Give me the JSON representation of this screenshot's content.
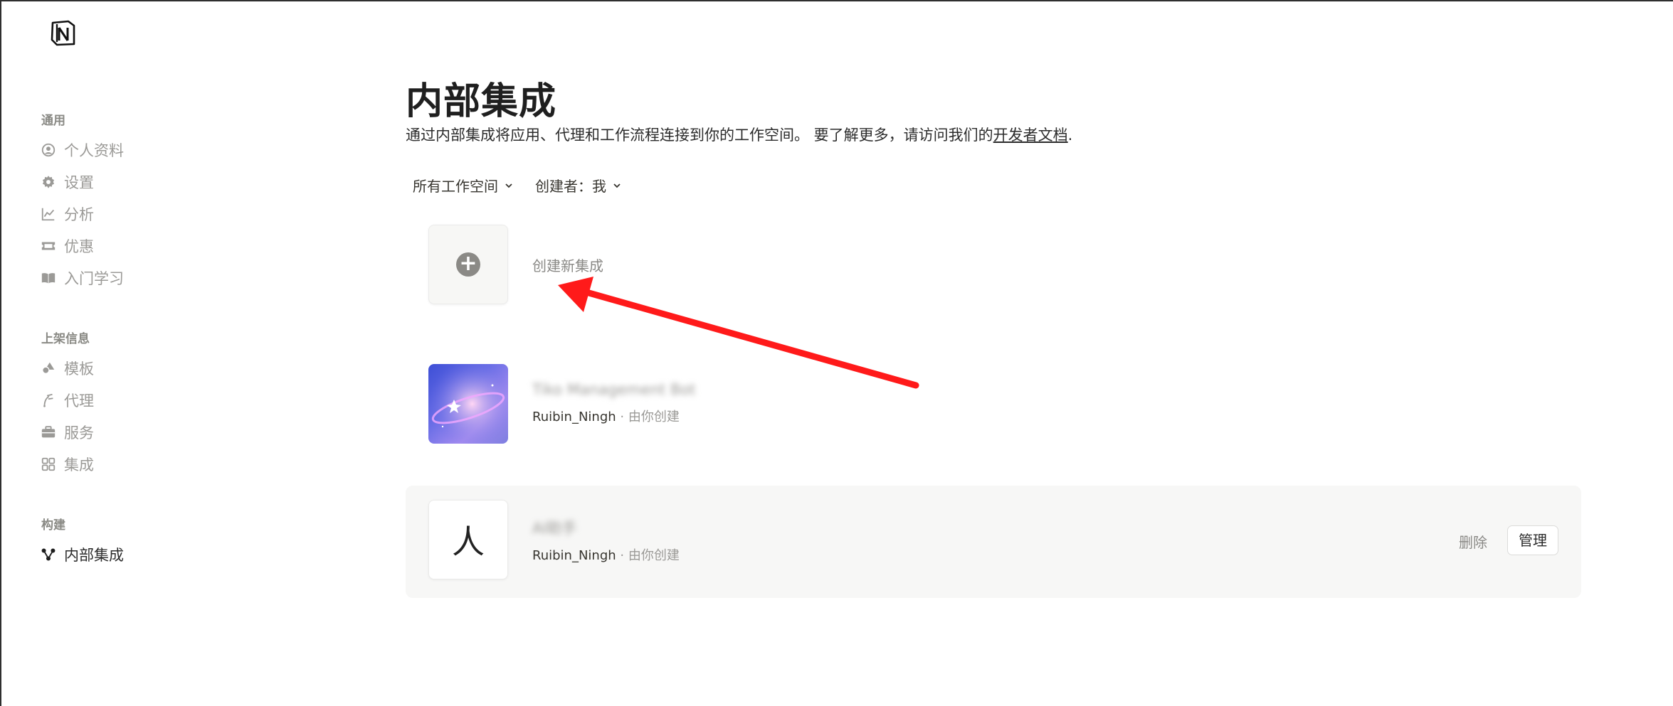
{
  "sidebar": {
    "sections": [
      {
        "title": "通用",
        "items": [
          {
            "label": "个人资料",
            "icon": "user-circle-icon"
          },
          {
            "label": "设置",
            "icon": "gear-icon"
          },
          {
            "label": "分析",
            "icon": "chart-line-icon"
          },
          {
            "label": "优惠",
            "icon": "ticket-icon"
          },
          {
            "label": "入门学习",
            "icon": "book-icon"
          }
        ]
      },
      {
        "title": "上架信息",
        "items": [
          {
            "label": "模板",
            "icon": "shapes-icon"
          },
          {
            "label": "代理",
            "icon": "agent-icon"
          },
          {
            "label": "服务",
            "icon": "briefcase-icon"
          },
          {
            "label": "集成",
            "icon": "grid-icon"
          }
        ]
      },
      {
        "title": "构建",
        "items": [
          {
            "label": "内部集成",
            "icon": "nodes-icon",
            "active": true
          }
        ]
      }
    ]
  },
  "main": {
    "title": "内部集成",
    "subtitle_prefix": "通过内部集成将应用、代理和工作流程连接到你的工作空间。 要了解更多，请访问我们的",
    "subtitle_link": "开发者文档",
    "subtitle_suffix": ".",
    "filters": {
      "workspace": "所有工作空间",
      "creator": "创建者：我"
    },
    "create_label": "创建新集成",
    "integrations": [
      {
        "name": "Tiko Management Bot",
        "owner": "Ruibin_Ningh",
        "by": " · 由你创建",
        "icon": "moon-image"
      },
      {
        "name": "AI助手",
        "owner": "Ruibin_Ningh",
        "by": " · 由你创建",
        "icon_glyph": "人"
      }
    ],
    "actions": {
      "delete": "删除",
      "manage": "管理"
    }
  },
  "colors": {
    "arrow": "#ff1a1a",
    "active_text": "#2b2b2b",
    "muted_text": "#9b9a97"
  }
}
